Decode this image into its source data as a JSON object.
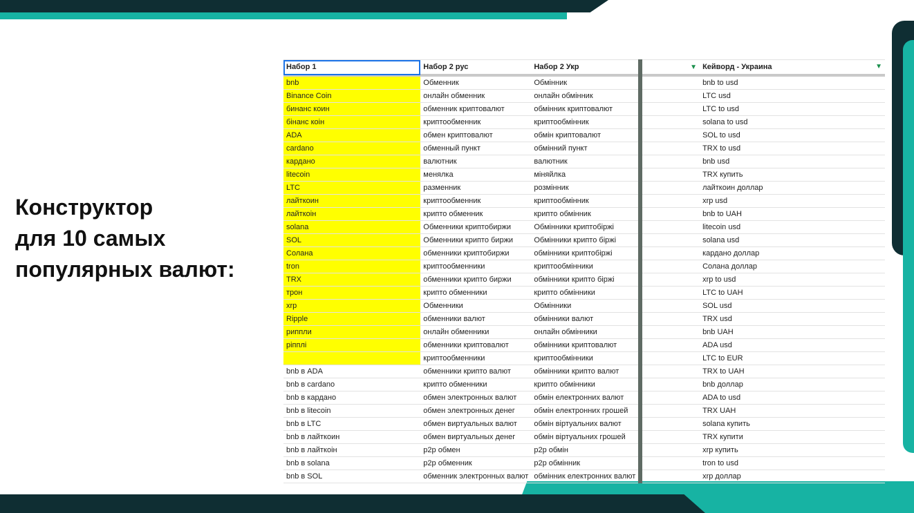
{
  "heading": {
    "line1": "Конструктор",
    "line2": "для 10 самых",
    "line3": "популярных валют:"
  },
  "sheet": {
    "headers": [
      "Набор 1",
      "Набор 2 рус",
      "Набор 2 Укр",
      "",
      "Кейворд - Украина"
    ],
    "filter_icon": "filter-icon",
    "highlight_color": "#ffff00",
    "rows": [
      [
        "bnb",
        "Обменник",
        "Обмінник",
        "",
        "bnb to usd"
      ],
      [
        "Binance Coin",
        "онлайн обменник",
        "онлайн обмінник",
        "",
        "LTC usd"
      ],
      [
        "бинанс коин",
        "обменник криптовалют",
        "обмінник криптовалют",
        "",
        "LTC to usd"
      ],
      [
        "бінанс коін",
        "криптообменник",
        "криптообмінник",
        "",
        "solana to usd"
      ],
      [
        "ADA",
        "обмен криптовалют",
        "обмін криптовалют",
        "",
        "SOL to usd"
      ],
      [
        "cardano",
        "обменный пункт",
        "обмінний пункт",
        "",
        "TRX to usd"
      ],
      [
        "кардано",
        "валютник",
        "валютник",
        "",
        "bnb usd"
      ],
      [
        "litecoin",
        "менялка",
        "міняйлка",
        "",
        "TRX купить"
      ],
      [
        "LTC",
        "разменник",
        "розмінник",
        "",
        "лайткоин доллар"
      ],
      [
        "лайткоин",
        "криптообменник",
        "криптообмінник",
        "",
        "xrp usd"
      ],
      [
        "лайткоін",
        "крипто обменник",
        "крипто обмінник",
        "",
        "bnb to UAH"
      ],
      [
        "solana",
        "Обменники криптобиржи",
        "Обмінники криптобіржі",
        "",
        "litecoin usd"
      ],
      [
        "SOL",
        "Обменники крипто биржи",
        "Обмінники крипто біржі",
        "",
        "solana usd"
      ],
      [
        "Солана",
        "обменники криптобиржи",
        "обмінники криптобіржі",
        "",
        "кардано доллар"
      ],
      [
        "tron",
        "криптообменники",
        "криптообмінники",
        "",
        "Солана доллар"
      ],
      [
        "TRX",
        "обменники крипто биржи",
        "обмінники крипто біржі",
        "",
        "xrp to usd"
      ],
      [
        "трон",
        "крипто обменники",
        "крипто обмінники",
        "",
        "LTC to UAH"
      ],
      [
        "xrp",
        "Обменники",
        "Обмінники",
        "",
        "SOL usd"
      ],
      [
        "Ripple",
        "обменники валют",
        "обмінники валют",
        "",
        "TRX usd"
      ],
      [
        "риппли",
        "онлайн обменники",
        "онлайн обмінники",
        "",
        "bnb UAH"
      ],
      [
        "ріпплі",
        "обменники криптовалют",
        "обмінники криптовалют",
        "",
        "ADA usd"
      ],
      [
        "",
        "криптообменники",
        "криптообмінники",
        "",
        "LTC to EUR"
      ],
      [
        "bnb в ADA",
        "обменники крипто валют",
        "обмінники крипто валют",
        "",
        "TRX to UAH"
      ],
      [
        "bnb в cardano",
        "крипто обменники",
        "крипто обмінники",
        "",
        "bnb доллар"
      ],
      [
        "bnb в кардано",
        "обмен электронных валют",
        "обмін електронних валют",
        "",
        "ADA to usd"
      ],
      [
        "bnb в litecoin",
        "обмен электронных денег",
        "обмін електронних грошей",
        "",
        "TRX UAH"
      ],
      [
        "bnb в LTC",
        "обмен виртуальных валют",
        "обмін віртуальних валют",
        "",
        "solana купить"
      ],
      [
        "bnb в лайткоин",
        "обмен виртуальных денег",
        "обмін віртуальних грошей",
        "",
        "TRX купити"
      ],
      [
        "bnb в лайткоін",
        "p2p обмен",
        "p2p обмін",
        "",
        "xrp купить"
      ],
      [
        "bnb в solana",
        "p2p обменник",
        "p2p обмінник",
        "",
        "tron to usd"
      ],
      [
        "bnb в SOL",
        "обменник электронных валют",
        "обмінник електронних валют",
        "",
        "xrp доллар"
      ]
    ],
    "highlighted_rows": 22
  }
}
